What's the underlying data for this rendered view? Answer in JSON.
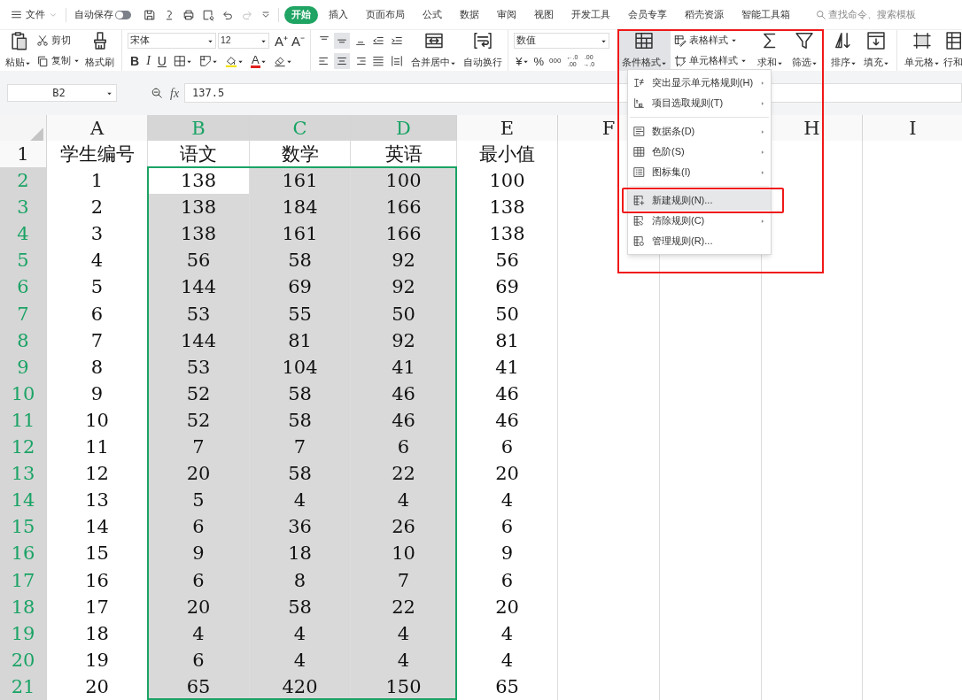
{
  "title_bar": {
    "file_menu": "文件",
    "autosave": {
      "label": "自动保存",
      "on": false
    },
    "tabs": [
      {
        "label": "开始",
        "selected": true
      },
      {
        "label": "插入",
        "selected": false
      },
      {
        "label": "页面布局",
        "selected": false
      },
      {
        "label": "公式",
        "selected": false
      },
      {
        "label": "数据",
        "selected": false
      },
      {
        "label": "审阅",
        "selected": false
      },
      {
        "label": "视图",
        "selected": false
      },
      {
        "label": "开发工具",
        "selected": false
      },
      {
        "label": "会员专享",
        "selected": false
      },
      {
        "label": "稻壳资源",
        "selected": false
      },
      {
        "label": "智能工具箱",
        "selected": false
      }
    ],
    "search": {
      "placeholder": "查找命令、搜索模板"
    }
  },
  "ribbon": {
    "paste": "粘贴",
    "cut": "剪切",
    "copy": "复制",
    "format_painter": "格式刷",
    "font_name": "宋体",
    "font_size": "12",
    "font_grow": "A⁺",
    "font_shrink": "A⁻",
    "bold": "B",
    "italic": "I",
    "underline": "U",
    "font_color": "A",
    "merge": "合并居中",
    "wrap": "自动换行",
    "number_format": "数值",
    "currency": "¥",
    "percent": "%",
    "thousands": "000",
    "decimal_increase": [
      "←.0",
      ".00"
    ],
    "decimal_decrease": [
      ".00",
      "→.0"
    ],
    "conditional_format": "条件格式",
    "conditional_format_open": true,
    "annotated": true,
    "table_style": "表格样式",
    "cell_style": "单元格样式",
    "sum": "求和",
    "filter": "筛选",
    "sort": "排序",
    "fill": "填充",
    "cell": "单元格",
    "rows_cols": "行和"
  },
  "formula_bar": {
    "name_box": "B2",
    "fx": "fx",
    "formula": "137.5"
  },
  "sheet": {
    "columns": [
      {
        "label": "A",
        "selected": false
      },
      {
        "label": "B",
        "selected": true
      },
      {
        "label": "C",
        "selected": true
      },
      {
        "label": "D",
        "selected": true
      },
      {
        "label": "E",
        "selected": false
      },
      {
        "label": "F",
        "selected": false
      },
      {},
      {
        "label": "H",
        "selected": false
      },
      {
        "label": "I",
        "selected": false
      }
    ],
    "rows": [
      {
        "number": "1",
        "selected": false,
        "cells": [
          "学生编号",
          "语文",
          "数学",
          "英语",
          "最小值"
        ]
      },
      {
        "number": "2",
        "selected": true,
        "cells": [
          "1",
          "138",
          "161",
          "100",
          "100"
        ]
      },
      {
        "number": "3",
        "selected": true,
        "cells": [
          "2",
          "138",
          "184",
          "166",
          "138"
        ]
      },
      {
        "number": "4",
        "selected": true,
        "cells": [
          "3",
          "138",
          "161",
          "166",
          "138"
        ]
      },
      {
        "number": "5",
        "selected": true,
        "cells": [
          "4",
          "56",
          "58",
          "92",
          "56"
        ]
      },
      {
        "number": "6",
        "selected": true,
        "cells": [
          "5",
          "144",
          "69",
          "92",
          "69"
        ]
      },
      {
        "number": "7",
        "selected": true,
        "cells": [
          "6",
          "53",
          "55",
          "50",
          "50"
        ]
      },
      {
        "number": "8",
        "selected": true,
        "cells": [
          "7",
          "144",
          "81",
          "92",
          "81"
        ]
      },
      {
        "number": "9",
        "selected": true,
        "cells": [
          "8",
          "53",
          "104",
          "41",
          "41"
        ]
      },
      {
        "number": "10",
        "selected": true,
        "cells": [
          "9",
          "52",
          "58",
          "46",
          "46"
        ]
      },
      {
        "number": "11",
        "selected": true,
        "cells": [
          "10",
          "52",
          "58",
          "46",
          "46"
        ]
      },
      {
        "number": "12",
        "selected": true,
        "cells": [
          "11",
          "7",
          "7",
          "6",
          "6"
        ]
      },
      {
        "number": "13",
        "selected": true,
        "cells": [
          "12",
          "20",
          "58",
          "22",
          "20"
        ]
      },
      {
        "number": "14",
        "selected": true,
        "cells": [
          "13",
          "5",
          "4",
          "4",
          "4"
        ]
      },
      {
        "number": "15",
        "selected": true,
        "cells": [
          "14",
          "6",
          "36",
          "26",
          "6"
        ]
      },
      {
        "number": "16",
        "selected": true,
        "cells": [
          "15",
          "9",
          "18",
          "10",
          "9"
        ]
      },
      {
        "number": "17",
        "selected": true,
        "cells": [
          "16",
          "6",
          "8",
          "7",
          "6"
        ]
      },
      {
        "number": "18",
        "selected": true,
        "cells": [
          "17",
          "20",
          "58",
          "22",
          "20"
        ]
      },
      {
        "number": "19",
        "selected": true,
        "cells": [
          "18",
          "4",
          "4",
          "4",
          "4"
        ]
      },
      {
        "number": "20",
        "selected": true,
        "cells": [
          "19",
          "6",
          "4",
          "4",
          "4"
        ]
      },
      {
        "number": "21",
        "selected": true,
        "cells": [
          "20",
          "65",
          "420",
          "150",
          "65"
        ]
      }
    ]
  },
  "conditional_format_menu": {
    "groups": [
      [
        {
          "label": "突出显示单元格规则(H)",
          "submenu": true,
          "hovered": false,
          "annotated": false
        },
        {
          "label": "项目选取规则(T)",
          "submenu": true,
          "hovered": false,
          "annotated": false
        }
      ],
      [
        {
          "label": "数据条(D)",
          "submenu": true,
          "hovered": false,
          "annotated": false
        },
        {
          "label": "色阶(S)",
          "submenu": true,
          "hovered": false,
          "annotated": false
        },
        {
          "label": "图标集(I)",
          "submenu": true,
          "hovered": false,
          "annotated": false
        }
      ],
      [
        {
          "label": "新建规则(N)...",
          "submenu": false,
          "hovered": true,
          "annotated": true
        },
        {
          "label": "清除规则(C)",
          "submenu": true,
          "hovered": false,
          "annotated": false
        },
        {
          "label": "管理规则(R)...",
          "submenu": false,
          "hovered": false,
          "annotated": false
        }
      ]
    ]
  }
}
